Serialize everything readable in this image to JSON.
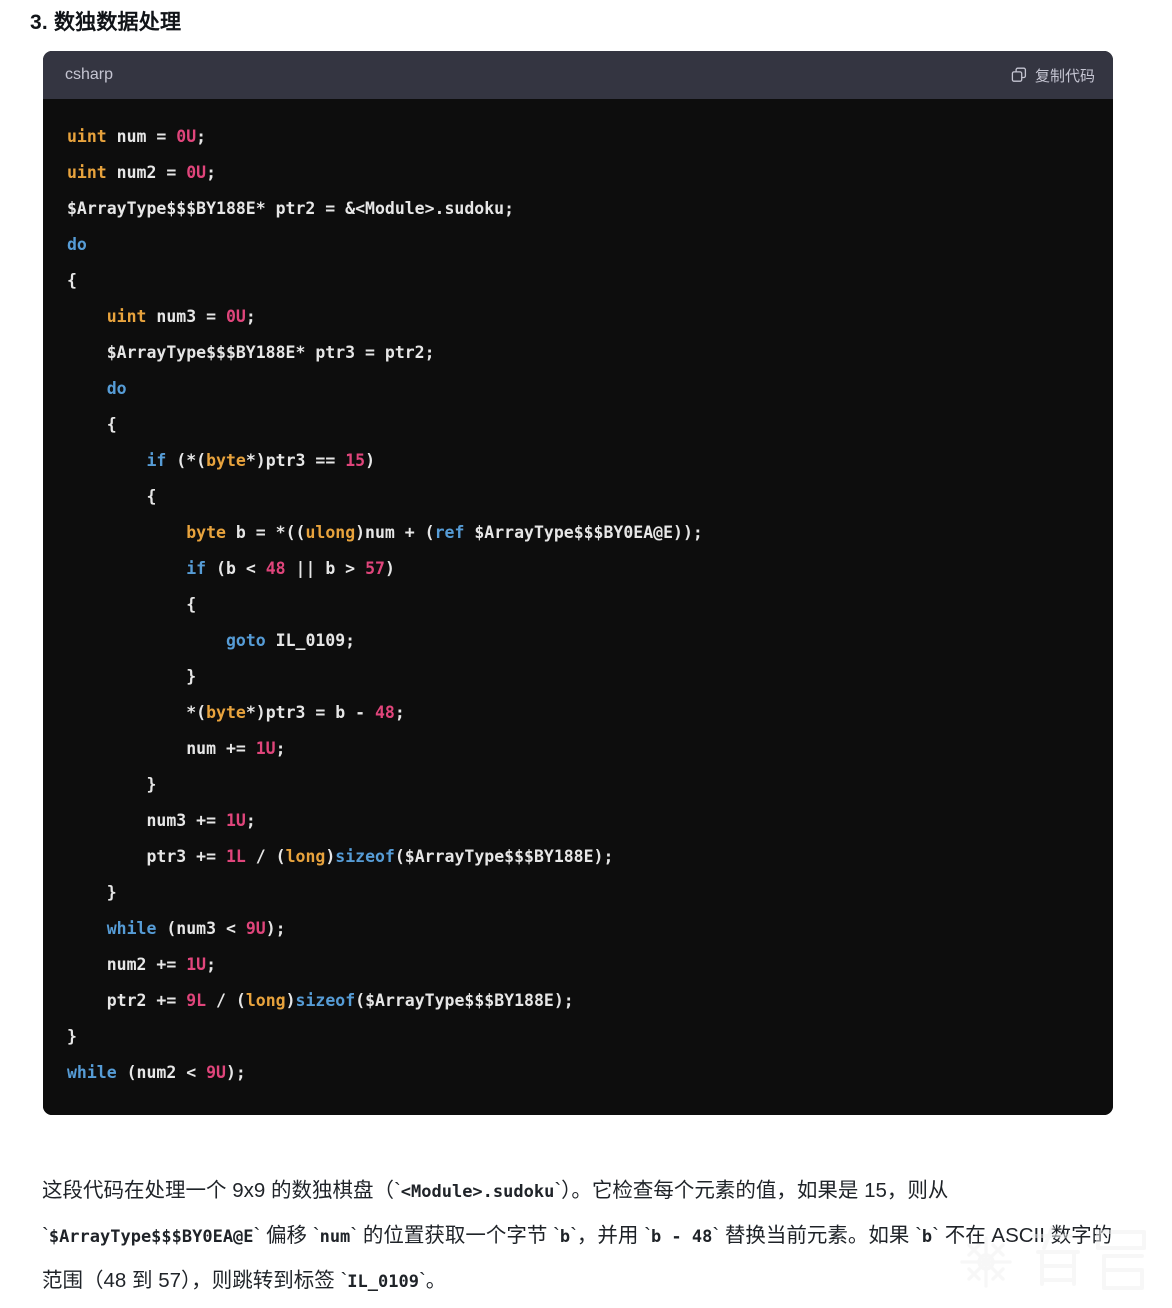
{
  "heading": "3. 数独数据处理",
  "code_block": {
    "language_label": "csharp",
    "copy_label": "复制代码",
    "copy_icon": "copy-icon",
    "lines": [
      [
        {
          "t": "uint",
          "c": "t"
        },
        {
          "t": " num ",
          "c": "p"
        },
        {
          "t": "= ",
          "c": "p"
        },
        {
          "t": "0U",
          "c": "n"
        },
        {
          "t": ";",
          "c": "p"
        }
      ],
      [
        {
          "t": "uint",
          "c": "t"
        },
        {
          "t": " num2 ",
          "c": "p"
        },
        {
          "t": "= ",
          "c": "p"
        },
        {
          "t": "0U",
          "c": "n"
        },
        {
          "t": ";",
          "c": "p"
        }
      ],
      [
        {
          "t": "$ArrayType$$$BY188E* ptr2 = &<Module>.sudoku;",
          "c": "p"
        }
      ],
      [
        {
          "t": "do",
          "c": "k"
        }
      ],
      [
        {
          "t": "{",
          "c": "p"
        }
      ],
      [
        {
          "t": "    ",
          "c": "p"
        },
        {
          "t": "uint",
          "c": "t"
        },
        {
          "t": " num3 = ",
          "c": "p"
        },
        {
          "t": "0U",
          "c": "n"
        },
        {
          "t": ";",
          "c": "p"
        }
      ],
      [
        {
          "t": "    $ArrayType$$$BY188E* ptr3 = ptr2;",
          "c": "p"
        }
      ],
      [
        {
          "t": "    ",
          "c": "p"
        },
        {
          "t": "do",
          "c": "k"
        }
      ],
      [
        {
          "t": "    {",
          "c": "p"
        }
      ],
      [
        {
          "t": "        ",
          "c": "p"
        },
        {
          "t": "if",
          "c": "k"
        },
        {
          "t": " (*(",
          "c": "p"
        },
        {
          "t": "byte",
          "c": "t"
        },
        {
          "t": "*)ptr3 == ",
          "c": "p"
        },
        {
          "t": "15",
          "c": "n"
        },
        {
          "t": ")",
          "c": "p"
        }
      ],
      [
        {
          "t": "        {",
          "c": "p"
        }
      ],
      [
        {
          "t": "            ",
          "c": "p"
        },
        {
          "t": "byte",
          "c": "t"
        },
        {
          "t": " b = *((",
          "c": "p"
        },
        {
          "t": "ulong",
          "c": "t"
        },
        {
          "t": ")num + (",
          "c": "p"
        },
        {
          "t": "ref",
          "c": "k"
        },
        {
          "t": " $ArrayType$$$BY0EA@E));",
          "c": "p"
        }
      ],
      [
        {
          "t": "            ",
          "c": "p"
        },
        {
          "t": "if",
          "c": "k"
        },
        {
          "t": " (b < ",
          "c": "p"
        },
        {
          "t": "48",
          "c": "n"
        },
        {
          "t": " || b > ",
          "c": "p"
        },
        {
          "t": "57",
          "c": "n"
        },
        {
          "t": ")",
          "c": "p"
        }
      ],
      [
        {
          "t": "            {",
          "c": "p"
        }
      ],
      [
        {
          "t": "                ",
          "c": "p"
        },
        {
          "t": "goto",
          "c": "k"
        },
        {
          "t": " IL_0109;",
          "c": "p"
        }
      ],
      [
        {
          "t": "            }",
          "c": "p"
        }
      ],
      [
        {
          "t": "            *(",
          "c": "p"
        },
        {
          "t": "byte",
          "c": "t"
        },
        {
          "t": "*)ptr3 = b - ",
          "c": "p"
        },
        {
          "t": "48",
          "c": "n"
        },
        {
          "t": ";",
          "c": "p"
        }
      ],
      [
        {
          "t": "            num += ",
          "c": "p"
        },
        {
          "t": "1U",
          "c": "n"
        },
        {
          "t": ";",
          "c": "p"
        }
      ],
      [
        {
          "t": "        }",
          "c": "p"
        }
      ],
      [
        {
          "t": "        num3 += ",
          "c": "p"
        },
        {
          "t": "1U",
          "c": "n"
        },
        {
          "t": ";",
          "c": "p"
        }
      ],
      [
        {
          "t": "        ptr3 += ",
          "c": "p"
        },
        {
          "t": "1L",
          "c": "n"
        },
        {
          "t": " / (",
          "c": "p"
        },
        {
          "t": "long",
          "c": "t"
        },
        {
          "t": ")",
          "c": "p"
        },
        {
          "t": "sizeof",
          "c": "k"
        },
        {
          "t": "($ArrayType$$$BY188E);",
          "c": "p"
        }
      ],
      [
        {
          "t": "    }",
          "c": "p"
        }
      ],
      [
        {
          "t": "    ",
          "c": "p"
        },
        {
          "t": "while",
          "c": "k"
        },
        {
          "t": " (num3 < ",
          "c": "p"
        },
        {
          "t": "9U",
          "c": "n"
        },
        {
          "t": ");",
          "c": "p"
        }
      ],
      [
        {
          "t": "    num2 += ",
          "c": "p"
        },
        {
          "t": "1U",
          "c": "n"
        },
        {
          "t": ";",
          "c": "p"
        }
      ],
      [
        {
          "t": "    ptr2 += ",
          "c": "p"
        },
        {
          "t": "9L",
          "c": "n"
        },
        {
          "t": " / (",
          "c": "p"
        },
        {
          "t": "long",
          "c": "t"
        },
        {
          "t": ")",
          "c": "p"
        },
        {
          "t": "sizeof",
          "c": "k"
        },
        {
          "t": "($ArrayType$$$BY188E);",
          "c": "p"
        }
      ],
      [
        {
          "t": "}",
          "c": "p"
        }
      ],
      [
        {
          "t": "while",
          "c": "k"
        },
        {
          "t": " (num2 < ",
          "c": "p"
        },
        {
          "t": "9U",
          "c": "n"
        },
        {
          "t": ");",
          "c": "p"
        }
      ]
    ]
  },
  "explanation": {
    "parts": [
      {
        "t": "这段代码在处理一个 9x9 的数独棋盘（`",
        "code": false
      },
      {
        "t": "<Module>.sudoku",
        "code": true
      },
      {
        "t": "`）。它检查每个元素的值，如果是 15，则从 `",
        "code": false
      },
      {
        "t": "$ArrayType$$$BY0EA@E",
        "code": true
      },
      {
        "t": "` 偏移 `",
        "code": false
      },
      {
        "t": "num",
        "code": true
      },
      {
        "t": "` 的位置获取一个字节 `",
        "code": false
      },
      {
        "t": "b",
        "code": true
      },
      {
        "t": "`，并用 `",
        "code": false
      },
      {
        "t": "b - 48",
        "code": true
      },
      {
        "t": "` 替换当前元素。如果 `",
        "code": false
      },
      {
        "t": "b",
        "code": true
      },
      {
        "t": "` 不在 ASCII 数字的范围（48 到 57），则跳转到标签 `",
        "code": false
      },
      {
        "t": "IL_0109",
        "code": true
      },
      {
        "t": "`。",
        "code": false
      }
    ]
  },
  "watermark": {
    "text": "看雪",
    "logo_icon": "snowflake-icon"
  },
  "colors": {
    "page_background": "#ffffff",
    "code_header_background": "#343541",
    "code_body_background": "#0d0d0d",
    "keyword": "#569cd6",
    "type": "#e8a33d",
    "number": "#e0457b",
    "plain_text": "#e6e6e6",
    "header_text": "#c5c5d2",
    "body_text": "#1f2328"
  }
}
